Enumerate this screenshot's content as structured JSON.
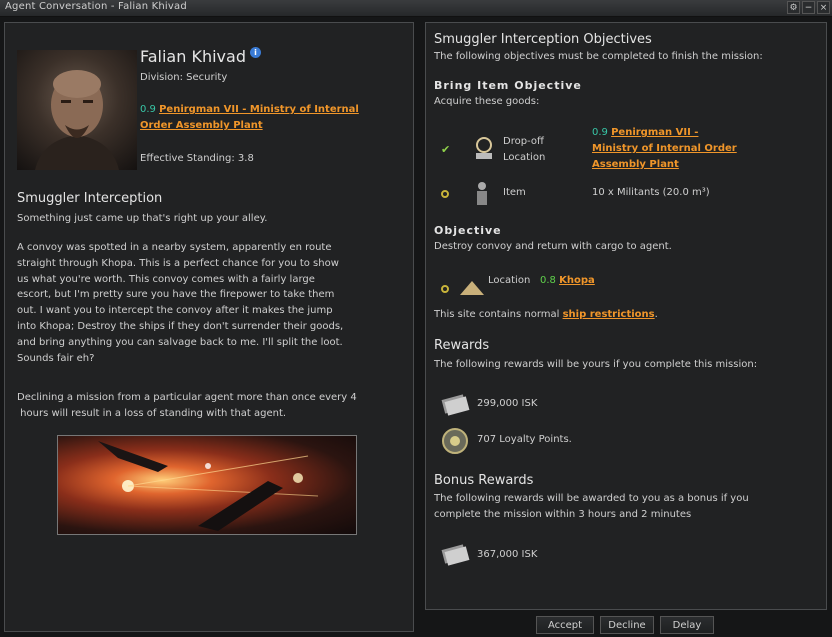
{
  "window": {
    "title": "Agent Conversation - Falian Khivad",
    "buttons": [
      "⚙",
      "−",
      "×"
    ]
  },
  "agent": {
    "name": "Falian Khivad",
    "division": "Division: Security",
    "location_sec": "0.9",
    "location_line1": "Penirgman VII - Ministry of Internal",
    "location_line2": "Order Assembly Plant",
    "standing": "Effective Standing: 3.8"
  },
  "mission": {
    "title": "Smuggler Interception",
    "intro": "Something just came up that's right up your alley.",
    "body": [
      "A convoy was spotted in a nearby system, apparently en route",
      "straight through Khopa. This is a perfect chance for you to show",
      "us what you're worth. This convoy comes with a fairly large",
      "escort, but I'm pretty sure you have the firepower to take them",
      "out. I want you to intercept the convoy after it makes the jump",
      "into Khopa; Destroy the ships if they don't surrender their goods,",
      "and bring anything you can salvage back to me. I'll split the loot.",
      "Sounds fair eh?"
    ],
    "warning1": "Declining a mission from a particular agent more than once every 4",
    "warning2": " hours will result in a loss of standing with that agent."
  },
  "objectives": {
    "title": "Smuggler Interception Objectives",
    "subtitle": "The following objectives must be completed to finish the mission:",
    "bring_header": "Bring Item Objective",
    "bring_sub": "Acquire these goods:",
    "dropoff_label1": "Drop-off",
    "dropoff_label2": "Location",
    "dropoff_sec": "0.9",
    "dropoff_line1": "Penirgman VII -",
    "dropoff_line2": "Ministry of Internal Order",
    "dropoff_line3": "Assembly Plant",
    "item_label": "Item",
    "item_value": "10 x Militants (20.0 m³)",
    "obj_header": "Objective",
    "obj_sub": "Destroy convoy and return with cargo to agent.",
    "loc_label": "Location",
    "loc_sec": "0.8",
    "loc_value": "Khopa",
    "site_text": "This site contains normal",
    "site_link": "ship restrictions",
    "site_end": "."
  },
  "rewards": {
    "title": "Rewards",
    "subtitle": "The following rewards will be yours if you complete this mission:",
    "isk": "299,000 ISK",
    "lp": "707 Loyalty Points."
  },
  "bonus": {
    "title": "Bonus Rewards",
    "line1": "The following rewards will be awarded to you as a bonus if you",
    "line2": "complete the mission within 3 hours and 2 minutes",
    "isk": "367,000 ISK"
  },
  "actions": {
    "accept": "Accept",
    "decline": "Decline",
    "delay": "Delay"
  }
}
